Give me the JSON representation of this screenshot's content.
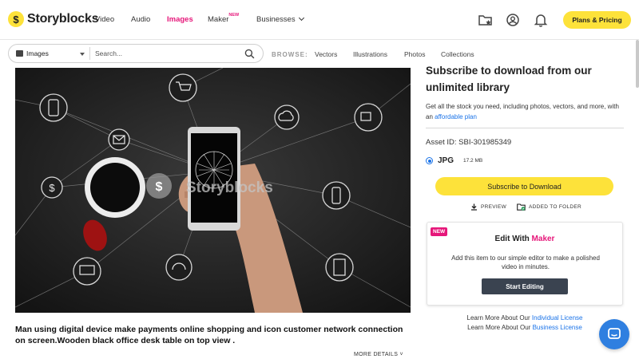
{
  "header": {
    "logo_mark": "$",
    "logo_text": "Storyblocks",
    "nav": [
      "Video",
      "Audio",
      "Images",
      "Maker",
      "Businesses"
    ],
    "maker_badge": "NEW",
    "active": "Images",
    "plans_label": "Plans & Pricing",
    "icons": [
      "saved-folder-icon",
      "account-icon",
      "bell-icon"
    ]
  },
  "search": {
    "type_label": "Images",
    "placeholder": "Search...",
    "browse_label": "BROWSE:",
    "browse_links": [
      "Vectors",
      "Illustrations",
      "Photos",
      "Collections"
    ]
  },
  "image": {
    "watermark": "Storyblocks",
    "watermark_mark": "$",
    "description": "Man using digital device make payments online shopping and icon customer network connection on screen.Wooden black office desk table on top view .",
    "more_details": "MORE DETAILS"
  },
  "panel": {
    "title": "Subscribe to download from our unlimited library",
    "body_prefix": "Get all the stock you need, including photos, vectors, and more, with an ",
    "body_link": "affordable plan",
    "asset_id": "Asset ID: SBI-301985349",
    "format": "JPG",
    "format_size": "17.2 MB",
    "subscribe_label": "Subscribe to Download",
    "preview_label": "PREVIEW",
    "added_label": "ADDED TO FOLDER"
  },
  "maker_card": {
    "badge": "NEW",
    "title_prefix": "Edit With ",
    "title_brand": "Maker",
    "body": "Add this item to our simple editor to make a polished video in minutes.",
    "button": "Start Editing"
  },
  "learn": {
    "prefix": "Learn More About Our ",
    "individual": "Individual License",
    "business": "Business License"
  },
  "colors": {
    "brand_yellow": "#fde23a",
    "accent_pink": "#e6177a",
    "link_blue": "#1a73e8",
    "chat_blue": "#2f7fe0"
  }
}
